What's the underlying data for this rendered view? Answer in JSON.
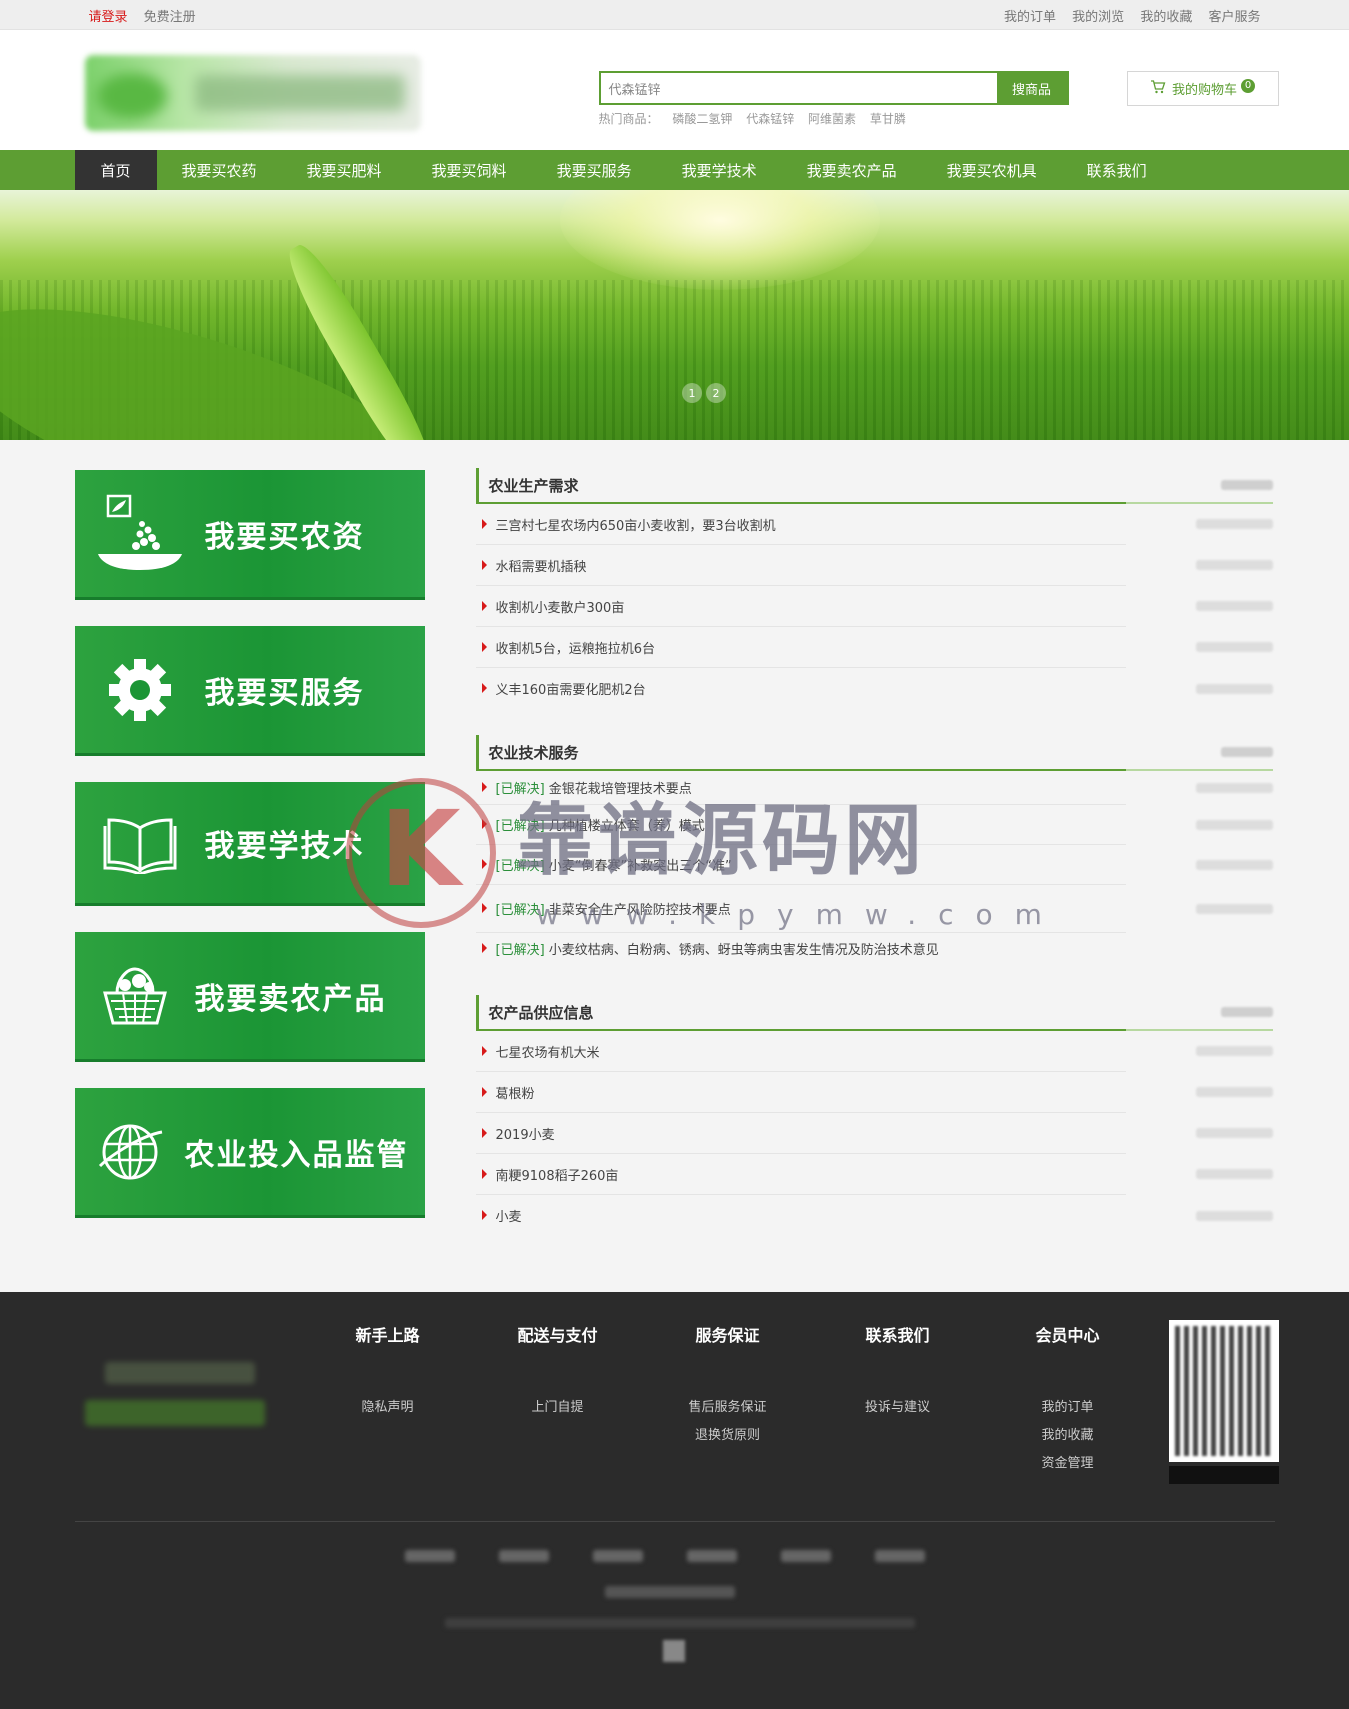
{
  "topbar": {
    "login": "请登录",
    "register": "免费注册",
    "links": [
      "我的订单",
      "我的浏览",
      "我的收藏",
      "客户服务"
    ]
  },
  "search": {
    "value": "代森锰锌",
    "button": "搜商品",
    "hot_label": "热门商品：",
    "hot_items": [
      "磷酸二氢钾",
      "代森锰锌",
      "阿维菌素",
      "草甘膦"
    ]
  },
  "cart": {
    "label": "我的购物车",
    "count": "0"
  },
  "nav": {
    "items": [
      "首页",
      "我要买农药",
      "我要买肥料",
      "我要买饲料",
      "我要买服务",
      "我要学技术",
      "我要卖农产品",
      "我要买农机具",
      "联系我们"
    ]
  },
  "banner": {
    "dots": [
      "1",
      "2"
    ]
  },
  "tiles": [
    "我要买农资",
    "我要买服务",
    "我要学技术",
    "我要卖农产品",
    "农业投入品监管"
  ],
  "sections": [
    {
      "title": "农业生产需求",
      "rows": [
        {
          "text": "三宫村七星农场内650亩小麦收割，要3台收割机"
        },
        {
          "text": "水稻需要机插秧"
        },
        {
          "text": "收割机小麦散户300亩"
        },
        {
          "text": "收割机5台，运粮拖拉机6台"
        },
        {
          "text": "义丰160亩需要化肥机2台"
        }
      ]
    },
    {
      "title": "农业技术服务",
      "rows": [
        {
          "tag": "[已解决]",
          "text": " 金银花栽培管理技术要点"
        },
        {
          "tag": "[已解决]",
          "text": " 几种植楼立体套（养）模式"
        },
        {
          "tag": "[已解决]",
          "text": " 小麦“倒春寒”补救突出三个“准”"
        },
        {
          "tag": "[已解决]",
          "text": " 韭菜安全生产风险防控技术要点"
        },
        {
          "tag": "[已解决]",
          "text": " 小麦纹枯病、白粉病、锈病、蚜虫等病虫害发生情况及防治技术意见"
        }
      ]
    },
    {
      "title": "农产品供应信息",
      "rows": [
        {
          "text": "七星农场有机大米"
        },
        {
          "text": "葛根粉"
        },
        {
          "text": "2019小麦"
        },
        {
          "text": "南粳9108稻子260亩"
        },
        {
          "text": "小麦"
        }
      ]
    }
  ],
  "watermark": {
    "title": "靠谱源码网",
    "url": "www.kpymw.com"
  },
  "footer": {
    "columns": [
      {
        "title": "新手上路",
        "links": [
          "隐私声明"
        ]
      },
      {
        "title": "配送与支付",
        "links": [
          "上门自提"
        ]
      },
      {
        "title": "服务保证",
        "links": [
          "售后服务保证",
          "退换货原则"
        ]
      },
      {
        "title": "联系我们",
        "links": [
          "投诉与建议"
        ]
      },
      {
        "title": "会员中心",
        "links": [
          "我的订单",
          "我的收藏",
          "资金管理"
        ]
      }
    ]
  },
  "colors": {
    "primary": "#5d9e33",
    "nav_active": "#333333",
    "tile": "#1b9535",
    "footer": "#2b2b2b",
    "accent_red": "#d71a1a"
  }
}
